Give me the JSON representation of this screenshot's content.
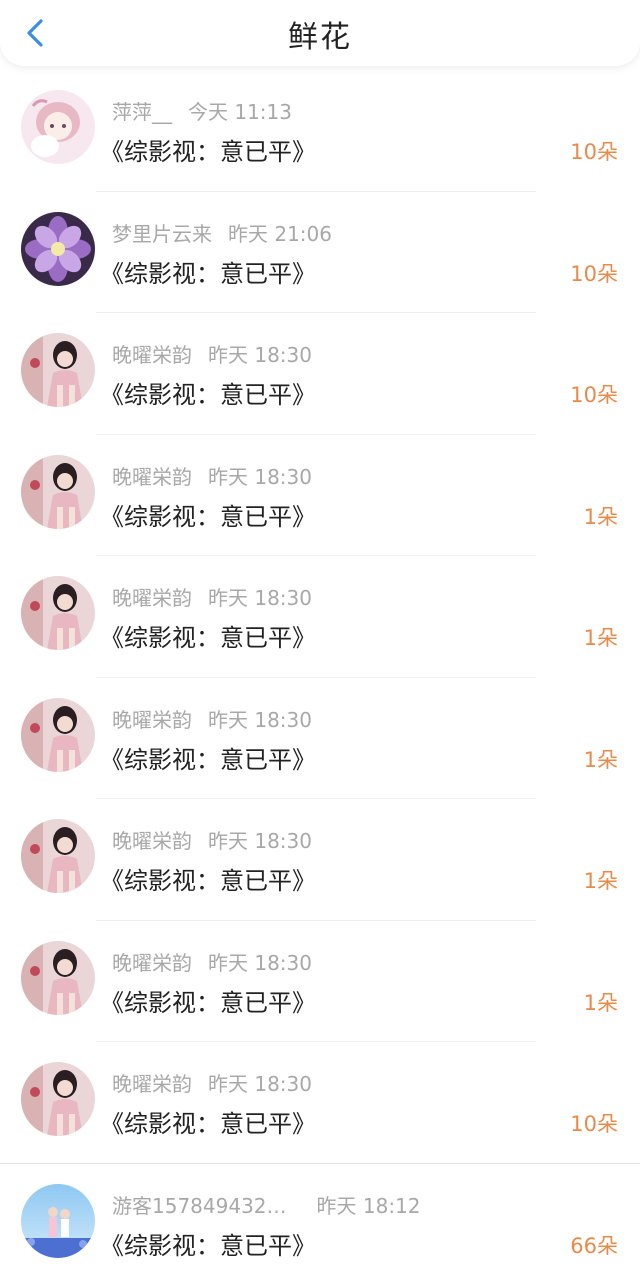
{
  "header": {
    "title": "鲜花",
    "back_icon": "chevron-left-icon",
    "accent_color": "#3a8ee6"
  },
  "colors": {
    "amount": "#e88a4a",
    "meta": "#a8a8a8",
    "text": "#222222"
  },
  "items": [
    {
      "user": "萍萍__",
      "time": "今天 11:13",
      "book": "《综影视：意已平》",
      "amount": "10朵",
      "avatar": "anime-girl-avatar"
    },
    {
      "user": "梦里片云来",
      "time": "昨天 21:06",
      "book": "《综影视：意已平》",
      "amount": "10朵",
      "avatar": "purple-flower-avatar"
    },
    {
      "user": "晚曜栄韵",
      "time": "昨天 18:30",
      "book": "《综影视：意已平》",
      "amount": "10朵",
      "avatar": "photo-girl-avatar"
    },
    {
      "user": "晚曜栄韵",
      "time": "昨天 18:30",
      "book": "《综影视：意已平》",
      "amount": "1朵",
      "avatar": "photo-girl-avatar"
    },
    {
      "user": "晚曜栄韵",
      "time": "昨天 18:30",
      "book": "《综影视：意已平》",
      "amount": "1朵",
      "avatar": "photo-girl-avatar"
    },
    {
      "user": "晚曜栄韵",
      "time": "昨天 18:30",
      "book": "《综影视：意已平》",
      "amount": "1朵",
      "avatar": "photo-girl-avatar"
    },
    {
      "user": "晚曜栄韵",
      "time": "昨天 18:30",
      "book": "《综影视：意已平》",
      "amount": "1朵",
      "avatar": "photo-girl-avatar"
    },
    {
      "user": "晚曜栄韵",
      "time": "昨天 18:30",
      "book": "《综影视：意已平》",
      "amount": "1朵",
      "avatar": "photo-girl-avatar"
    },
    {
      "user": "晚曜栄韵",
      "time": "昨天 18:30",
      "book": "《综影视：意已平》",
      "amount": "10朵",
      "avatar": "photo-girl-avatar"
    },
    {
      "user": "游客157849432…",
      "time": "昨天 18:12",
      "book": "《综影视：意已平》",
      "amount": "66朵",
      "avatar": "sky-couple-avatar"
    }
  ]
}
